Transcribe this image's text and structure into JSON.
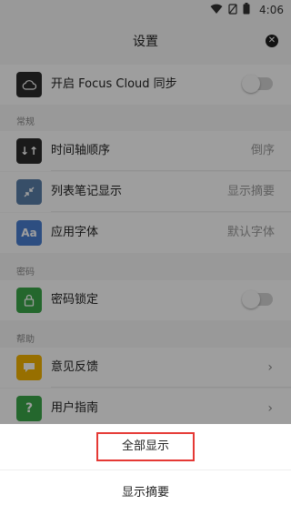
{
  "status_bar": {
    "time": "4:06"
  },
  "header": {
    "title": "设置"
  },
  "sync": {
    "label": "开启 Focus Cloud 同步"
  },
  "sections": {
    "general": "常规",
    "password": "密码",
    "help": "帮助"
  },
  "general_items": [
    {
      "label": "时间轴顺序",
      "value": "倒序"
    },
    {
      "label": "列表笔记显示",
      "value": "显示摘要"
    },
    {
      "label": "应用字体",
      "value": "默认字体",
      "icon_text": "Aa"
    }
  ],
  "password_items": [
    {
      "label": "密码锁定"
    }
  ],
  "help_items": [
    {
      "label": "意见反馈"
    },
    {
      "label": "用户指南"
    }
  ],
  "sheet": {
    "options": [
      "全部显示",
      "显示摘要"
    ]
  },
  "colors": {
    "highlight_border": "#e53935",
    "icon_dark": "#2b2b2b",
    "icon_blue": "#4a7fd1",
    "icon_steel": "#5a7ea8",
    "icon_yellow": "#f4b400",
    "icon_green": "#3aa64a"
  }
}
